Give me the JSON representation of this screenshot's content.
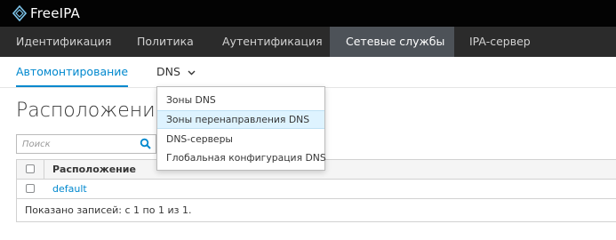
{
  "app": {
    "logo_text": "FreeIPA"
  },
  "nav": {
    "items": [
      {
        "label": "Идентификация"
      },
      {
        "label": "Политика"
      },
      {
        "label": "Аутентификация"
      },
      {
        "label": "Сетевые службы"
      },
      {
        "label": "IPA-сервер"
      }
    ],
    "active_index": 3
  },
  "subnav": {
    "items": [
      {
        "label": "Автомонтирование"
      },
      {
        "label": "DNS"
      }
    ]
  },
  "dropdown": {
    "items": [
      {
        "label": "Зоны DNS"
      },
      {
        "label": "Зоны перенаправления DNS"
      },
      {
        "label": "DNS-серверы"
      },
      {
        "label": "Глобальная конфигурация DNS"
      }
    ],
    "highlighted_index": 1
  },
  "page": {
    "title": "Расположения IPA"
  },
  "search": {
    "placeholder": "Поиск"
  },
  "table": {
    "header": {
      "column": "Расположение"
    },
    "rows": [
      {
        "name": "default"
      }
    ],
    "footer": "Показано записей: с 1 по 1 из 1."
  },
  "colors": {
    "topbar": "#030303",
    "navbar": "#2b2b2b",
    "nav_active": "#4d5258",
    "link": "#0088ce",
    "highlight": "#def3ff"
  }
}
